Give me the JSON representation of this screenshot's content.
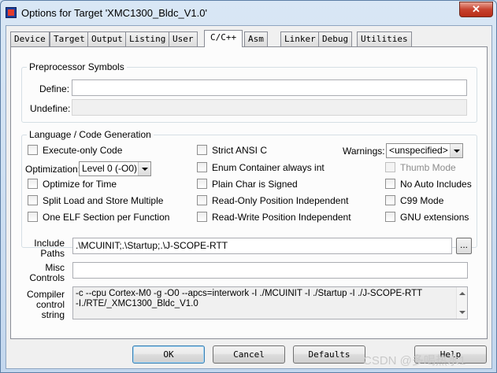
{
  "window": {
    "title": "Options for Target 'XMC1300_Bldc_V1.0'",
    "close_glyph": "✕"
  },
  "tabs": [
    {
      "label": "Device"
    },
    {
      "label": "Target"
    },
    {
      "label": "Output"
    },
    {
      "label": "Listing"
    },
    {
      "label": "User"
    },
    {
      "label": "C/C++"
    },
    {
      "label": "Asm"
    },
    {
      "label": "Linker"
    },
    {
      "label": "Debug"
    },
    {
      "label": "Utilities"
    }
  ],
  "active_tab": "C/C++",
  "preprocessor": {
    "title": "Preprocessor Symbols",
    "define_label": "Define:",
    "define_value": "",
    "undefine_label": "Undefine:",
    "undefine_value": ""
  },
  "language": {
    "title": "Language / Code Generation",
    "execute_only": {
      "label": "Execute-only Code",
      "checked": false
    },
    "optimization_label": "Optimization:",
    "optimization_value": "Level 0 (-O0)",
    "optimize_time": {
      "label": "Optimize for Time",
      "checked": false
    },
    "split_load": {
      "label": "Split Load and Store Multiple",
      "checked": false
    },
    "one_elf": {
      "label": "One ELF Section per Function",
      "checked": false
    },
    "strict_ansi": {
      "label": "Strict ANSI C",
      "checked": false
    },
    "enum_container": {
      "label": "Enum Container always int",
      "checked": false
    },
    "plain_char": {
      "label": "Plain Char is Signed",
      "checked": false
    },
    "ro_pos": {
      "label": "Read-Only Position Independent",
      "checked": false
    },
    "rw_pos": {
      "label": "Read-Write Position Independent",
      "checked": false
    },
    "warnings_label": "Warnings:",
    "warnings_value": "<unspecified>",
    "thumb_mode": {
      "label": "Thumb Mode",
      "checked": false,
      "disabled": true
    },
    "no_auto_includes": {
      "label": "No Auto Includes",
      "checked": false
    },
    "c99_mode": {
      "label": "C99 Mode",
      "checked": false
    },
    "gnu_ext": {
      "label": "GNU extensions",
      "checked": false
    }
  },
  "include_paths": {
    "label_line1": "Include",
    "label_line2": "Paths",
    "value": ".\\MCUINIT;.\\Startup;.\\J-SCOPE-RTT",
    "browse_label": "..."
  },
  "misc_controls": {
    "label_line1": "Misc",
    "label_line2": "Controls",
    "value": ""
  },
  "compiler_string": {
    "label_line1": "Compiler",
    "label_line2": "control",
    "label_line3": "string",
    "line1": "-c --cpu Cortex-M0 -g -O0 --apcs=interwork -I ./MCUINIT -I ./Startup -I ./J-SCOPE-RTT",
    "line2": "-I./RTE/_XMC1300_Bldc_V1.0"
  },
  "buttons": {
    "ok": "OK",
    "cancel": "Cancel",
    "defaults": "Defaults",
    "help": "Help"
  },
  "watermark": "CSDN @多喝热水1"
}
